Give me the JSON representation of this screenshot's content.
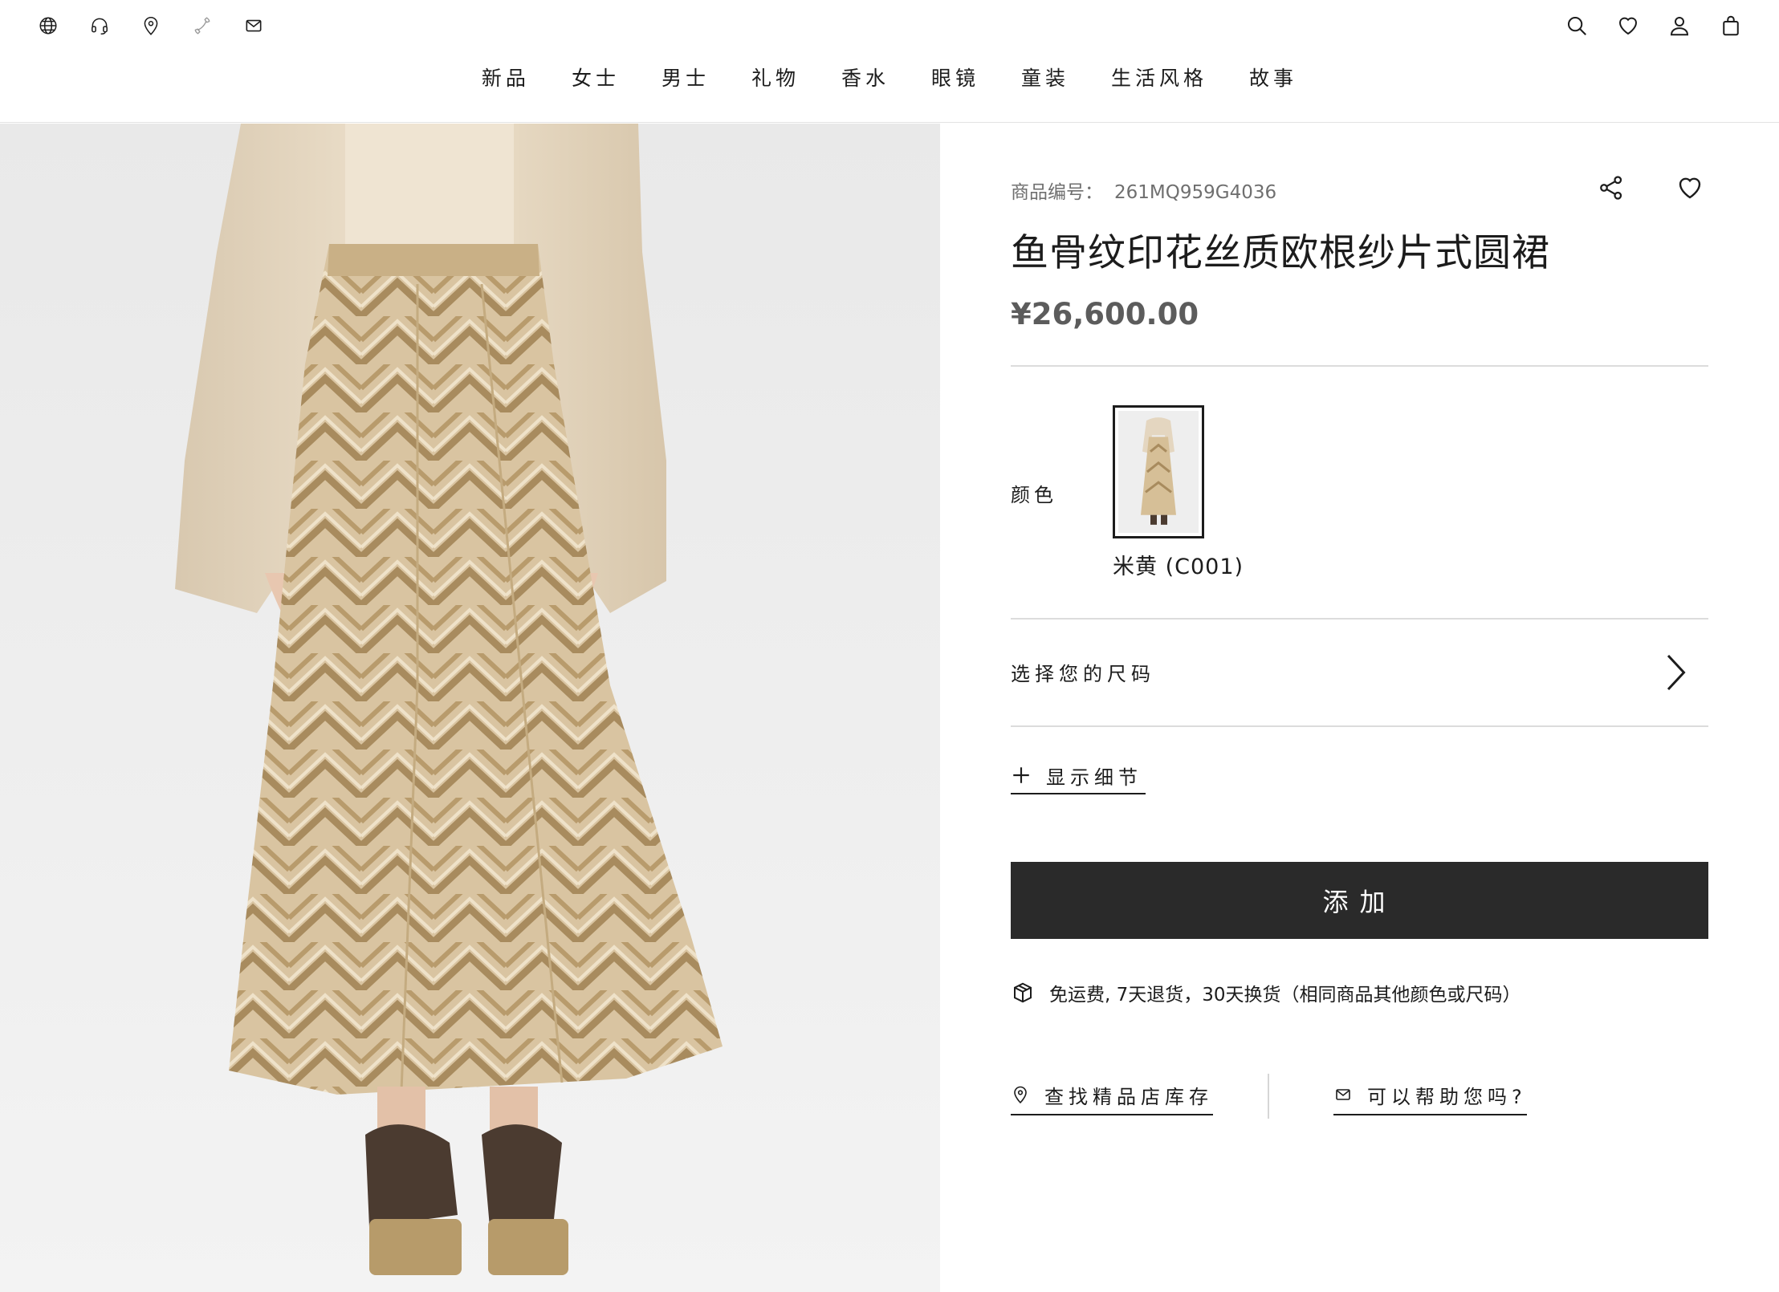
{
  "header": {
    "utility_icons": [
      "globe-icon",
      "headset-icon",
      "location-pin-icon",
      "phone-icon",
      "mail-icon"
    ],
    "action_icons": [
      "search-icon",
      "heart-icon",
      "user-icon",
      "shopping-bag-icon"
    ],
    "nav": [
      "新品",
      "女士",
      "男士",
      "礼物",
      "香水",
      "眼镜",
      "童装",
      "生活风格",
      "故事"
    ]
  },
  "product": {
    "sku_label": "商品编号：",
    "sku_value": "261MQ959G4036",
    "title": "鱼骨纹印花丝质欧根纱片式圆裙",
    "price": "¥26,600.00",
    "color_label": "颜色",
    "selected_color": "米黄 (C001)",
    "size_label": "选择您的尺码",
    "details_label": "显示细节",
    "add_button": "添加",
    "shipping_note": "免运费, 7天退货，30天换货（相同商品其他颜色或尺码）",
    "store_link": "查找精品店库存",
    "help_link": "可以帮助您吗?"
  },
  "colors": {
    "button_bg": "#2a2a2a",
    "price": "#5c5c5c",
    "text": "#1c1c1c",
    "divider": "#dcdcdc"
  }
}
